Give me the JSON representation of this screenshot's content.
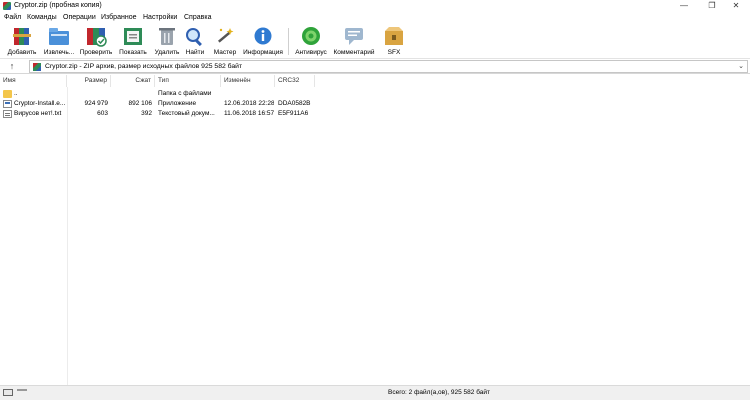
{
  "window": {
    "title": "Cryptor.zip (пробная копия)",
    "controls": {
      "minimize": "—",
      "restore": "❐",
      "close": "✕"
    }
  },
  "menu": [
    "Файл",
    "Команды",
    "Операции",
    "Избранное",
    "Настройки",
    "Справка"
  ],
  "toolbar": {
    "buttons": [
      {
        "label": "Добавить",
        "icon": "add-icon"
      },
      {
        "label": "Извлечь...",
        "icon": "extract-icon"
      },
      {
        "label": "Проверить",
        "icon": "test-icon"
      },
      {
        "label": "Показать",
        "icon": "view-icon"
      },
      {
        "label": "Удалить",
        "icon": "delete-icon"
      },
      {
        "label": "Найти",
        "icon": "find-icon"
      },
      {
        "label": "Мастер",
        "icon": "wizard-icon"
      },
      {
        "label": "Информация",
        "icon": "info-icon"
      },
      {
        "label": "Антивирус",
        "icon": "antivirus-icon"
      },
      {
        "label": "Комментарий",
        "icon": "comment-icon"
      },
      {
        "label": "SFX",
        "icon": "sfx-icon"
      }
    ]
  },
  "address": {
    "text": "Cryptor.zip - ZIP архив, размер исходных файлов 925 582 байт"
  },
  "columns": [
    "Имя",
    "Размер",
    "Сжат",
    "Тип",
    "Изменён",
    "CRC32"
  ],
  "files": [
    {
      "name": "..",
      "size": "",
      "packed": "",
      "type": "Папка с файлами",
      "modified": "",
      "crc": "",
      "kind": "folder"
    },
    {
      "name": "Cryptor-Install.e...",
      "size": "924 979",
      "packed": "892 106",
      "type": "Приложение",
      "modified": "12.06.2018 22:28",
      "crc": "DDA0582B",
      "kind": "exe"
    },
    {
      "name": "Вирусов нет!.txt",
      "size": "603",
      "packed": "392",
      "type": "Текстовый докум...",
      "modified": "11.06.2018 16:57",
      "crc": "E5F911A6",
      "kind": "txt"
    }
  ],
  "status": {
    "text": "Всего: 2 файл(а,ов), 925 582 байт"
  },
  "colors": {
    "accent": "#2f5fb0",
    "folder": "#f3c64b",
    "statusbar_bg": "#f0f0f0"
  }
}
